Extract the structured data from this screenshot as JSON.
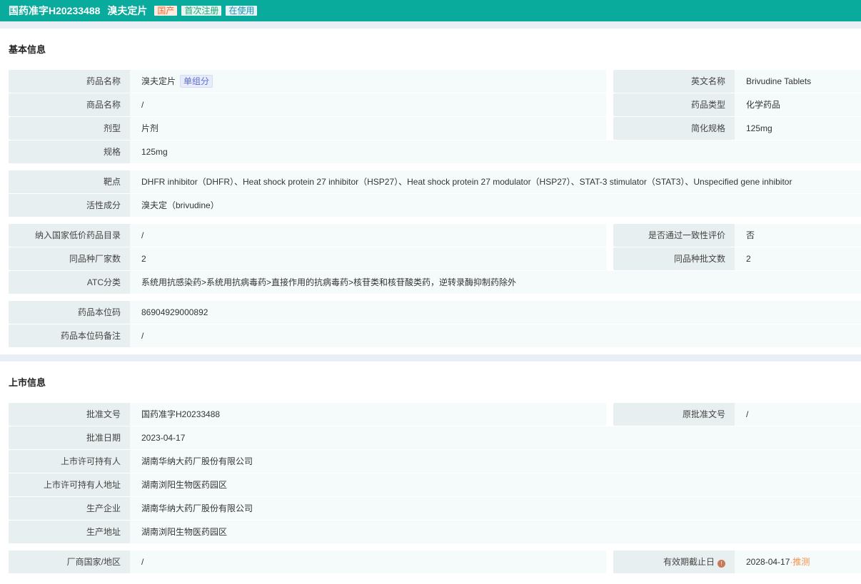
{
  "header": {
    "title": "国药准字H20233488",
    "name": "溴夫定片",
    "tags": [
      {
        "label": "国产",
        "c": "o"
      },
      {
        "label": "首次注册",
        "c": "g"
      },
      {
        "label": "在使用",
        "c": "b"
      }
    ]
  },
  "sections": [
    {
      "title": "基本信息",
      "groups": [
        [
          {
            "l": "药品名称",
            "v": "溴夫定片",
            "chip": "单组分",
            "l2": "英文名称",
            "v2": "Brivudine Tablets"
          },
          {
            "l": "商品名称",
            "v": "/",
            "l2": "药品类型",
            "v2": "化学药品"
          },
          {
            "l": "剂型",
            "v": "片剂",
            "l2": "简化规格",
            "v2": "125mg"
          },
          {
            "l": "规格",
            "v": "125mg"
          }
        ],
        [
          {
            "l": "靶点",
            "v": "DHFR inhibitor（DHFR）、Heat shock protein 27 inhibitor（HSP27）、Heat shock protein 27 modulator（HSP27）、STAT-3 stimulator（STAT3）、Unspecified gene inhibitor"
          },
          {
            "l": "活性成分",
            "v": "溴夫定（brivudine）"
          }
        ],
        [
          {
            "l": "纳入国家低价药品目录",
            "v": "/",
            "l2": "是否通过一致性评价",
            "v2": "否"
          },
          {
            "l": "同品种厂家数",
            "v": "2",
            "l2": "同品种批文数",
            "v2": "2"
          },
          {
            "l": "ATC分类",
            "v": "系统用抗感染药>系统用抗病毒药>直接作用的抗病毒药>核苷类和核苷酸类药，逆转录酶抑制药除外"
          }
        ],
        [
          {
            "l": "药品本位码",
            "v": "86904929000892"
          },
          {
            "l": "药品本位码备注",
            "v": "/"
          }
        ]
      ]
    },
    {
      "title": "上市信息",
      "groups": [
        [
          {
            "l": "批准文号",
            "v": "国药准字H20233488",
            "l2": "原批准文号",
            "v2": "/"
          },
          {
            "l": "批准日期",
            "v": "2023-04-17"
          },
          {
            "l": "上市许可持有人",
            "v": "湖南华纳大药厂股份有限公司"
          },
          {
            "l": "上市许可持有人地址",
            "v": "湖南浏阳生物医药园区"
          },
          {
            "l": "生产企业",
            "v": "湖南华纳大药厂股份有限公司"
          },
          {
            "l": "生产地址",
            "v": "湖南浏阳生物医药园区"
          }
        ],
        [
          {
            "l": "厂商国家/地区",
            "v": "/",
            "l2": "有效期截止日",
            "info": "i",
            "v2": "2028-04-17",
            "note": "·推测"
          }
        ]
      ]
    }
  ]
}
